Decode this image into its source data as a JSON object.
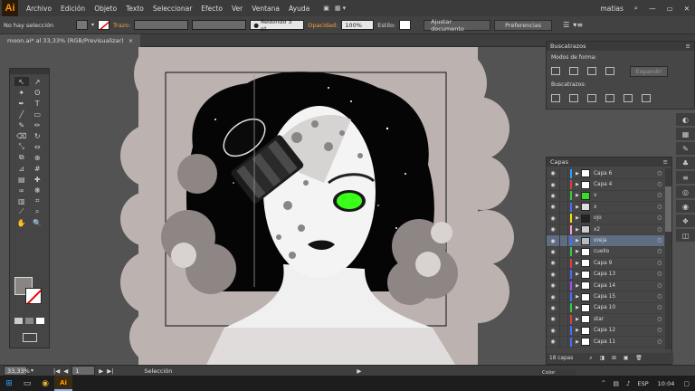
{
  "app": {
    "logo_text": "Ai"
  },
  "menubar": {
    "items": [
      "Archivo",
      "Edición",
      "Objeto",
      "Texto",
      "Seleccionar",
      "Efecto",
      "Ver",
      "Ventana",
      "Ayuda"
    ],
    "user": "matias"
  },
  "control_bar": {
    "selection_label": "No hay selección",
    "stroke_label": "Trazo:",
    "brush_value": "Redondo 3 pt.",
    "opacity_label": "Opacidad:",
    "opacity_value": "100%",
    "style_label": "Estilo:",
    "fit_button": "Ajustar documento",
    "prefs_button": "Preferencias"
  },
  "document": {
    "tab_title": "moon.ai* al 33,33% (RGB/Previsualizar)",
    "close_glyph": "×"
  },
  "pathfinder": {
    "title": "Buscatrazos",
    "shape_modes_label": "Modos de forma:",
    "expand_button": "Expandir",
    "pathfinders_label": "Buscatrazos:"
  },
  "layers": {
    "title": "Capas",
    "count_label": "18 capas",
    "items": [
      {
        "name": "Capa 6",
        "color": "#2aa0ff",
        "thumb": "#ffffff"
      },
      {
        "name": "Capa 4",
        "color": "#d94040",
        "thumb": "#ffffff"
      },
      {
        "name": "v",
        "color": "#2ecc40",
        "thumb": "#3adb2a"
      },
      {
        "name": "x",
        "color": "#4a6cff",
        "thumb": "#dddddd"
      },
      {
        "name": "ojo",
        "color": "#f5e400",
        "thumb": "#222222"
      },
      {
        "name": "x2",
        "color": "#ff9ad0",
        "thumb": "#cccccc"
      },
      {
        "name": "oreja",
        "color": "#4a6cff",
        "thumb": "#bbbbbb"
      },
      {
        "name": "cuello",
        "color": "#2ecc40",
        "thumb": "#ffffff"
      },
      {
        "name": "Capa 9",
        "color": "#d94040",
        "thumb": "#ffffff"
      },
      {
        "name": "Capa 13",
        "color": "#4a6cff",
        "thumb": "#ffffff"
      },
      {
        "name": "Capa 14",
        "color": "#a050ff",
        "thumb": "#ffffff"
      },
      {
        "name": "Capa 15",
        "color": "#4a6cff",
        "thumb": "#ffffff"
      },
      {
        "name": "Capa 10",
        "color": "#2ecc40",
        "thumb": "#ffffff"
      },
      {
        "name": "star",
        "color": "#d94040",
        "thumb": "#ffffff"
      },
      {
        "name": "Capa 12",
        "color": "#4a6cff",
        "thumb": "#ffffff"
      },
      {
        "name": "Capa 11",
        "color": "#4a6cff",
        "thumb": "#ffffff"
      }
    ],
    "selected_index": 6
  },
  "colors_panel": {
    "title": "Color"
  },
  "status": {
    "zoom": "33,33%",
    "page": "1",
    "tool": "Selección"
  },
  "taskbar": {
    "lang": "ESP",
    "time": "10:04"
  }
}
